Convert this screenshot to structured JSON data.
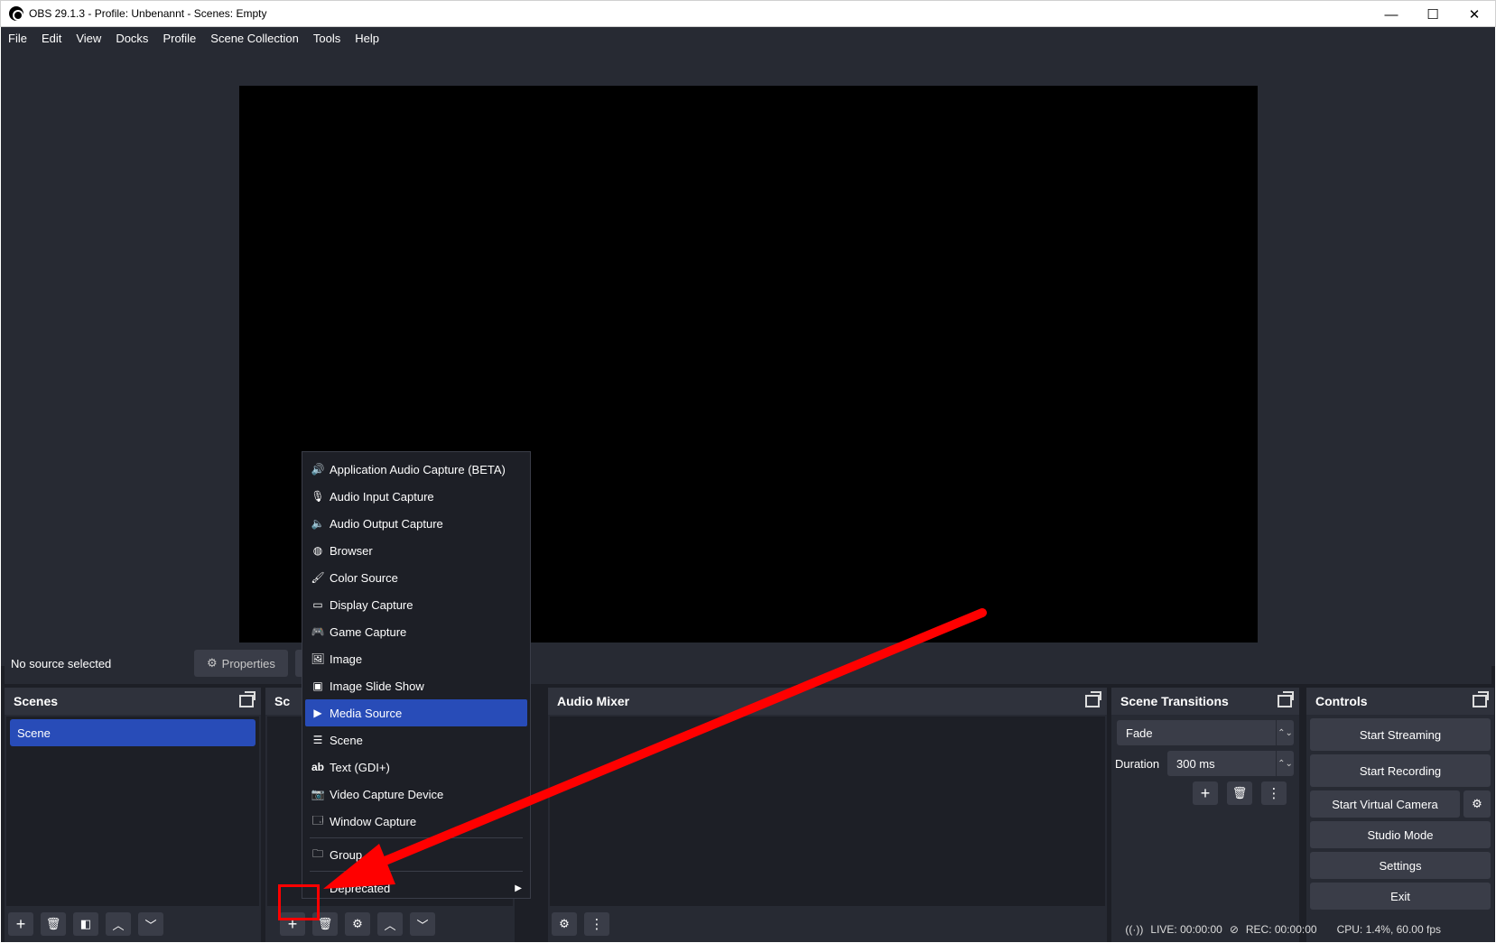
{
  "window": {
    "title": "OBS 29.1.3 - Profile: Unbenannt - Scenes: Empty",
    "minimize": "—",
    "maximize": "☐",
    "close": "✕"
  },
  "menu": [
    "File",
    "Edit",
    "View",
    "Docks",
    "Profile",
    "Scene Collection",
    "Tools",
    "Help"
  ],
  "source_bar": {
    "status": "No source selected",
    "properties_label": "Properties"
  },
  "scenes": {
    "title": "Scenes",
    "items": [
      "Scene"
    ]
  },
  "sources": {
    "title": "Sc"
  },
  "audio_mixer": {
    "title": "Audio Mixer"
  },
  "transitions": {
    "title": "Scene Transitions",
    "selected": "Fade",
    "duration_label": "Duration",
    "duration_value": "300 ms"
  },
  "controls": {
    "title": "Controls",
    "start_streaming": "Start Streaming",
    "start_recording": "Start Recording",
    "start_virtual_camera": "Start Virtual Camera",
    "studio_mode": "Studio Mode",
    "settings": "Settings",
    "exit": "Exit"
  },
  "context_menu": {
    "items": [
      {
        "label": "Application Audio Capture (BETA)",
        "icon": "app-audio-icon"
      },
      {
        "label": "Audio Input Capture",
        "icon": "microphone-icon"
      },
      {
        "label": "Audio Output Capture",
        "icon": "speaker-icon"
      },
      {
        "label": "Browser",
        "icon": "globe-icon"
      },
      {
        "label": "Color Source",
        "icon": "brush-icon"
      },
      {
        "label": "Display Capture",
        "icon": "monitor-icon"
      },
      {
        "label": "Game Capture",
        "icon": "gamepad-icon"
      },
      {
        "label": "Image",
        "icon": "image-icon"
      },
      {
        "label": "Image Slide Show",
        "icon": "slideshow-icon"
      },
      {
        "label": "Media Source",
        "icon": "play-icon"
      },
      {
        "label": "Scene",
        "icon": "list-icon"
      },
      {
        "label": "Text (GDI+)",
        "icon": "text-icon"
      },
      {
        "label": "Video Capture Device",
        "icon": "camera-icon"
      },
      {
        "label": "Window Capture",
        "icon": "window-icon"
      }
    ],
    "group": "Group",
    "deprecated": "Deprecated",
    "selected_index": 9
  },
  "status": {
    "live": "LIVE: 00:00:00",
    "rec": "REC: 00:00:00",
    "cpu": "CPU: 1.4%, 60.00 fps"
  },
  "annotation_color": "#ff0000"
}
